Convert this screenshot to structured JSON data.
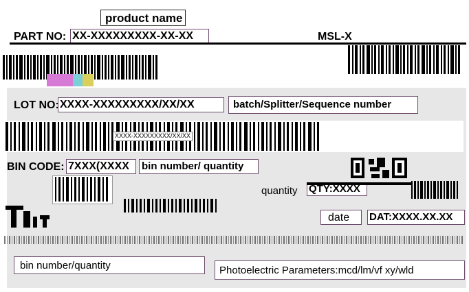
{
  "label": {
    "product_name": "product name",
    "part_no_label": "PART NO:",
    "part_no_value": "XX-XXXXXXXXX-XX-XX",
    "msl": "MSL-X",
    "lot_no_label": "LOT NO:",
    "lot_no_value": "XXXX-XXXXXXXXX/XX/XX",
    "batch_caption": "batch/Splitter/Sequence number",
    "lot_barcode_text": "XXXX-XXXXXXXXX/XX/XX",
    "bin_code_label": "BIN CODE:",
    "bin_code_value": "7XXX(XXXX",
    "bin_caption": "bin number/ quantity",
    "quantity_label": "quantity",
    "qty_value": "QTY:XXXX",
    "date_label": "date",
    "date_value": "DAT:XXXX.XX.XX",
    "bottom_left_caption": "bin number/quantity",
    "photo_caption": "Photoelectric Parameters:mcd/lm/vf xy/wld"
  },
  "colors": {
    "box_border": "#6b4a6b",
    "gray_panel": "#e7e7e7",
    "magenta": "#d67ad6",
    "cyan": "#7ad0d6",
    "yellow": "#d8d05a"
  }
}
